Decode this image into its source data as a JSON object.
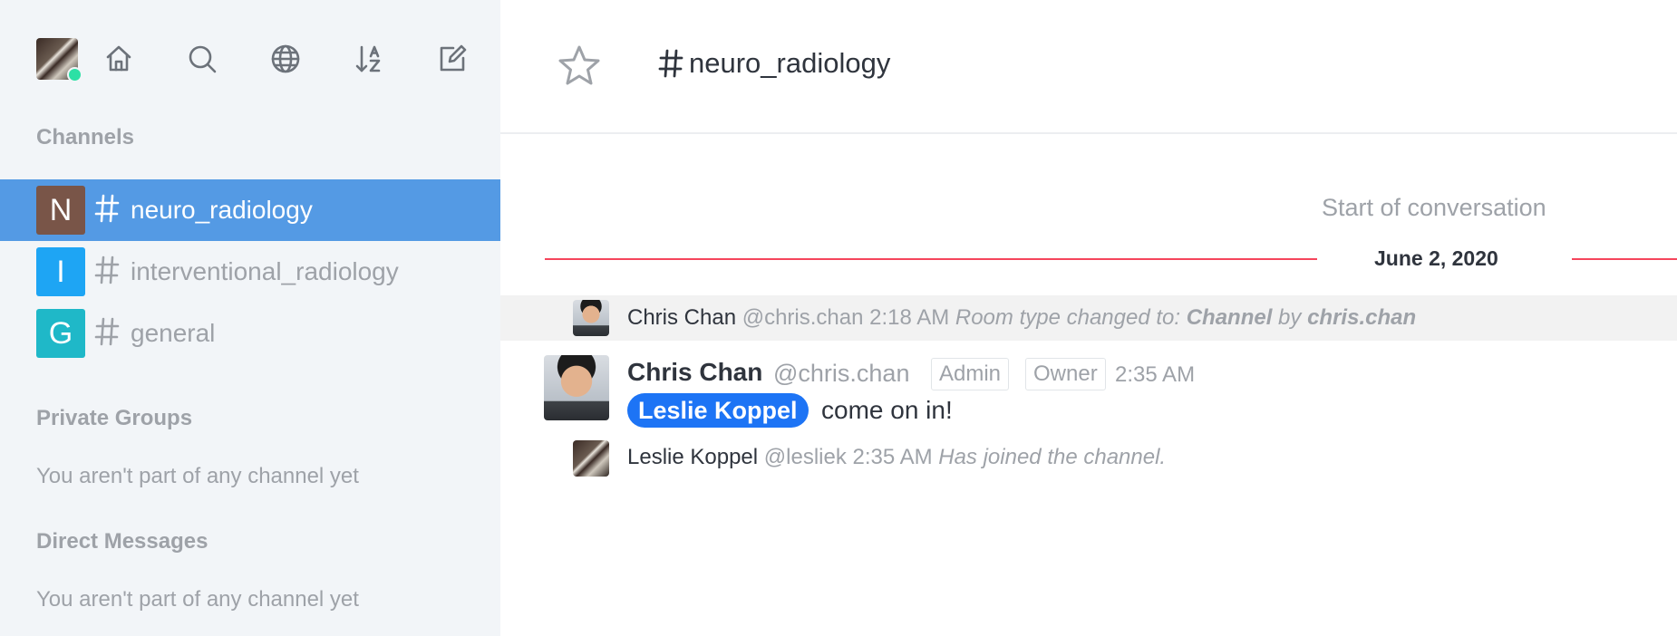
{
  "sidebar": {
    "toolbar": {
      "home": "home-icon",
      "search": "search-icon",
      "directory": "globe-icon",
      "sort": "sort-az-icon",
      "create": "edit-icon"
    },
    "channels_title": "Channels",
    "channels": [
      {
        "initial": "N",
        "name": "neuro_radiology",
        "color": "#795548",
        "active": true
      },
      {
        "initial": "I",
        "name": "interventional_radiology",
        "color": "#1ea5f4",
        "active": false
      },
      {
        "initial": "G",
        "name": "general",
        "color": "#1fb8c8",
        "active": false
      }
    ],
    "private_groups_title": "Private Groups",
    "private_groups_empty": "You aren't part of any channel yet",
    "direct_messages_title": "Direct Messages",
    "direct_messages_empty": "You aren't part of any channel yet"
  },
  "header": {
    "room_name": "neuro_radiology"
  },
  "conversation": {
    "start_label": "Start of conversation",
    "date": "June 2, 2020",
    "messages": [
      {
        "type": "system",
        "name": "Chris Chan",
        "handle": "@chris.chan",
        "time": "2:18 AM",
        "text_prefix": "Room type changed to: ",
        "text_bold": "Channel",
        "text_mid": " by ",
        "text_by": "chris.chan"
      },
      {
        "type": "message",
        "name": "Chris Chan",
        "handle": "@chris.chan",
        "roles": [
          "Admin",
          "Owner"
        ],
        "time": "2:35 AM",
        "mention": "Leslie Koppel",
        "body": "come on in!"
      },
      {
        "type": "system",
        "name": "Leslie Koppel",
        "handle": "@lesliek",
        "time": "2:35 AM",
        "text": "Has joined the channel."
      }
    ]
  },
  "colors": {
    "accent": "#549ae4",
    "date_divider": "#f5455c",
    "mention_bg": "#1d74f5",
    "online": "#2de0a5"
  }
}
